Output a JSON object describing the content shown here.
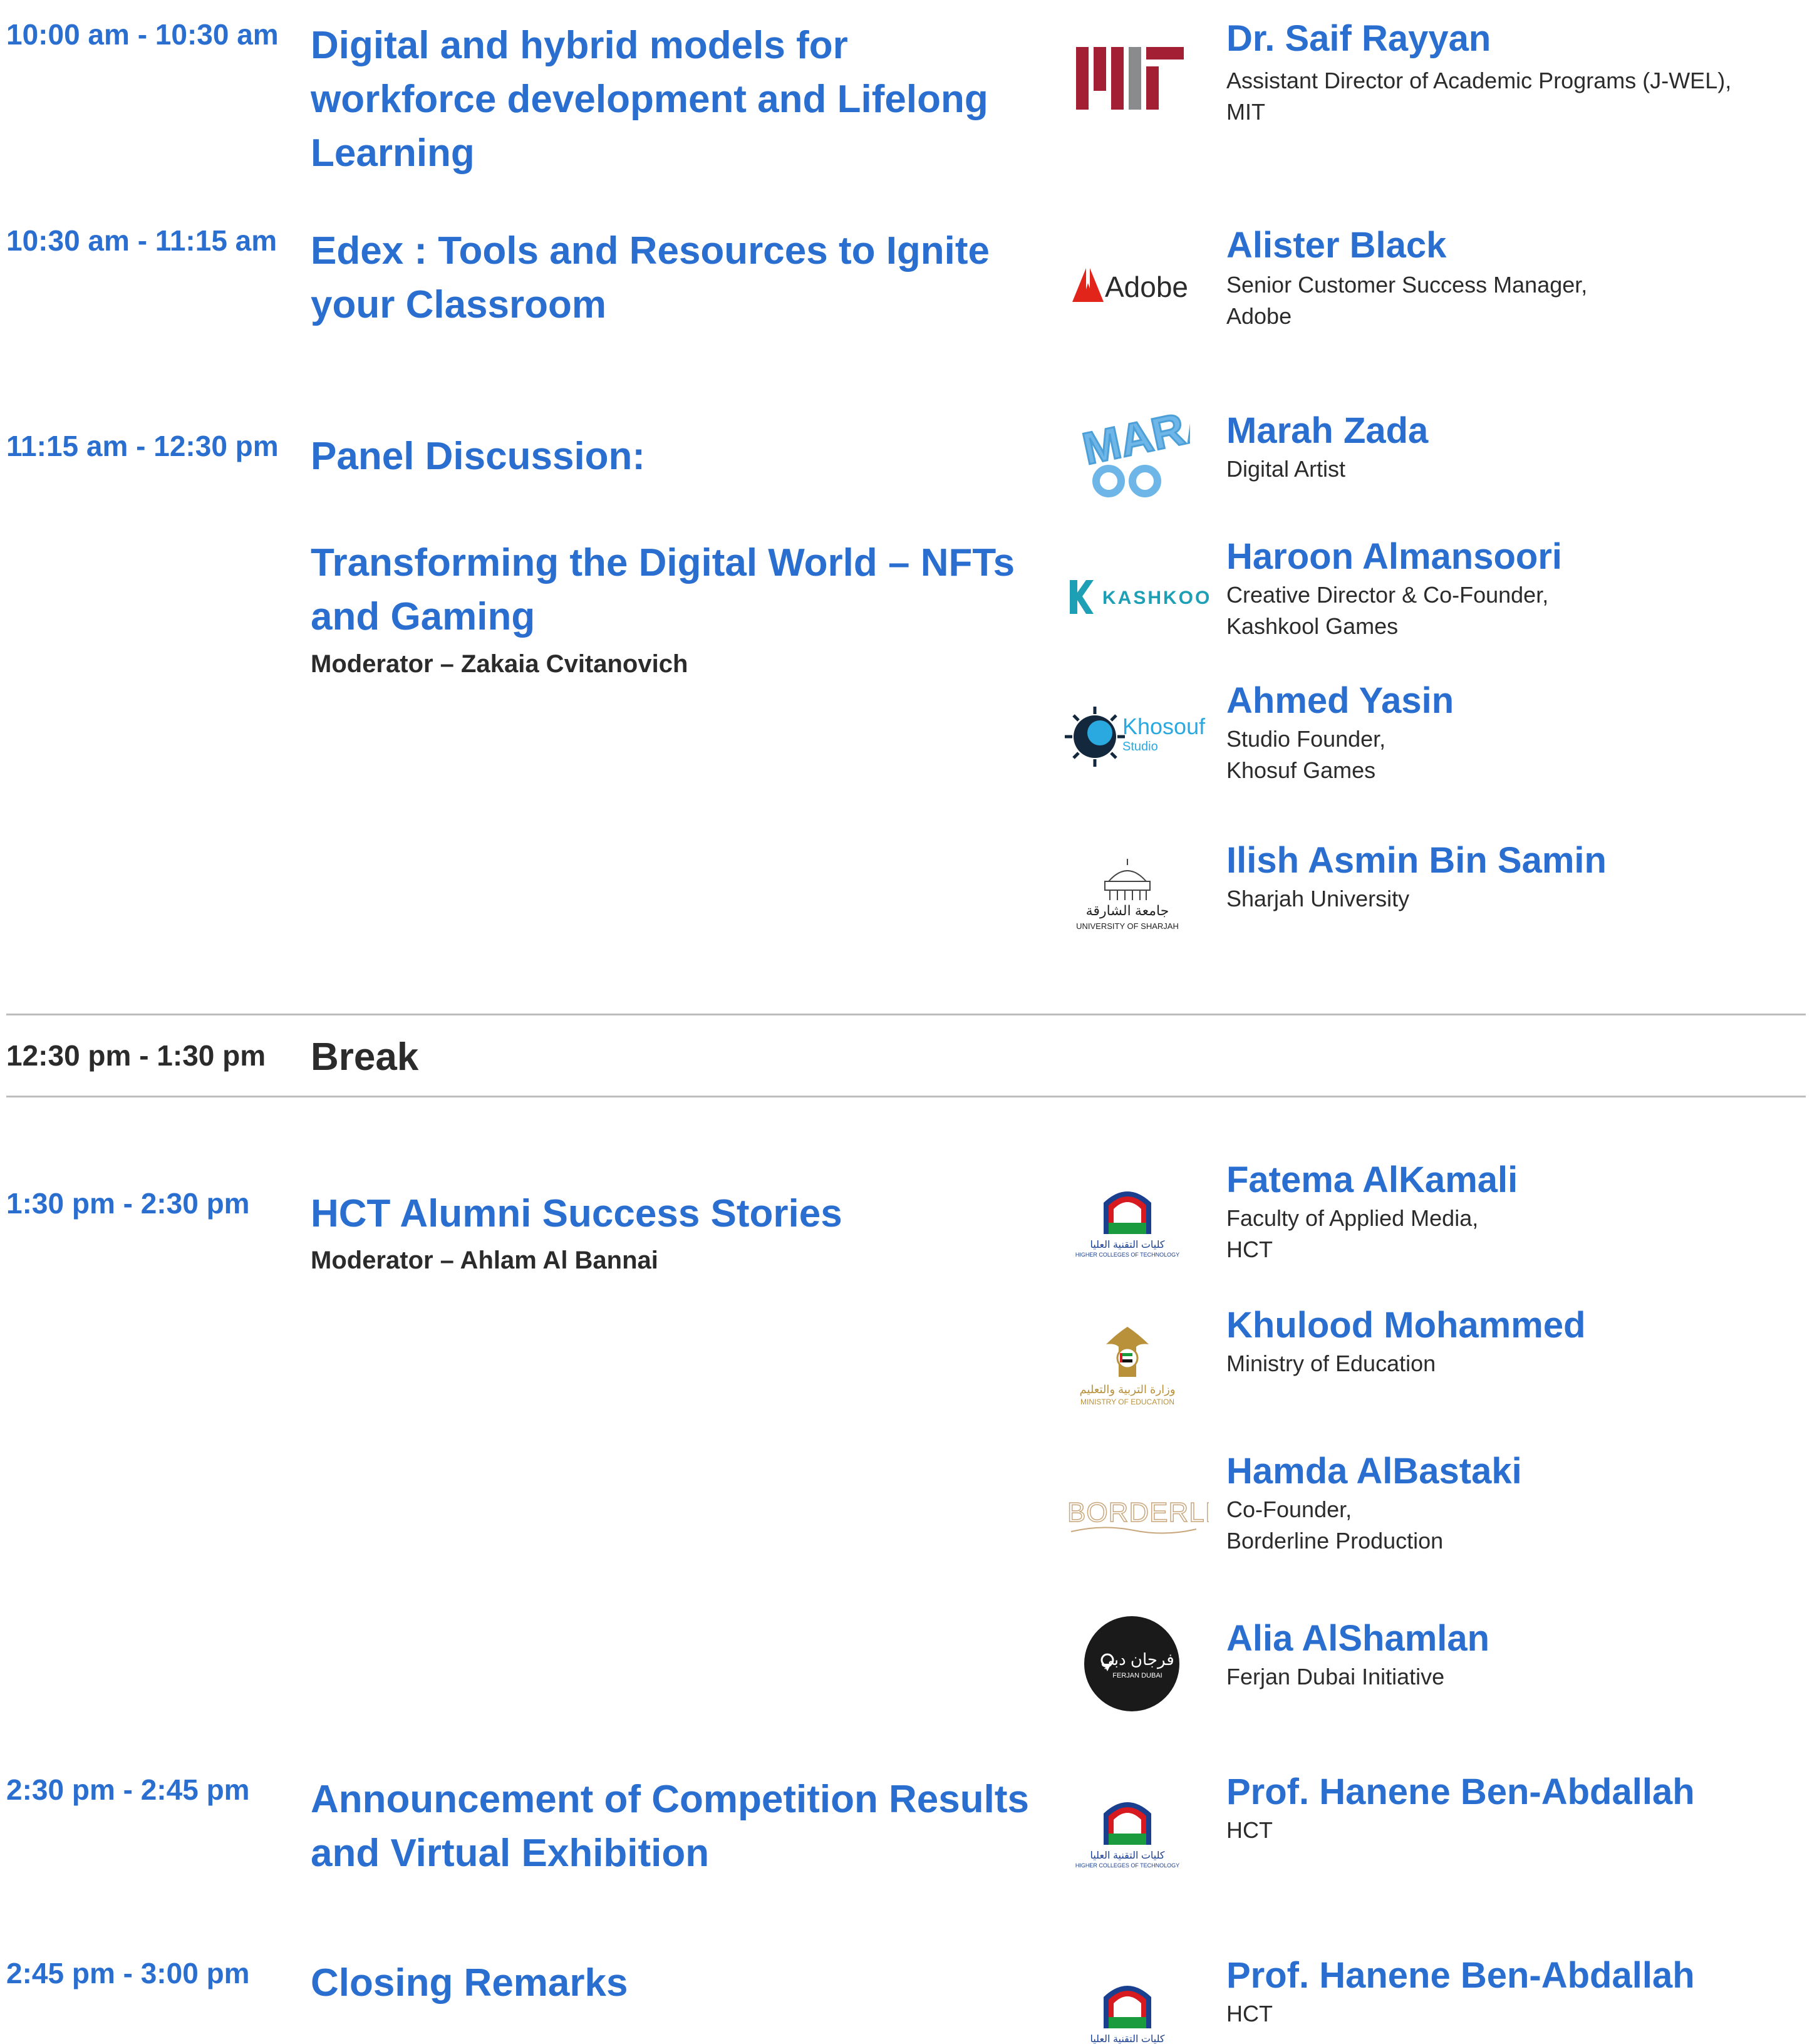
{
  "colors": {
    "accent": "#2a6fd0",
    "text": "#2b2b2b",
    "rule": "#bdbdbd"
  },
  "sessions": [
    {
      "time": "10:00 am - 10:30 am",
      "title": "Digital and hybrid models for workforce development and Lifelong Learning"
    },
    {
      "time": "10:30 am - 11:15 am",
      "title": "Edex : Tools and Resources to Ignite your Classroom"
    },
    {
      "time": "11:15 am - 12:30 pm",
      "title": "Panel Discussion:",
      "subtitle": "Transforming the Digital World – NFTs and Gaming",
      "moderator": "Moderator – Zakaia Cvitanovich"
    },
    {
      "time": "12:30 pm - 1:30 pm",
      "title": "Break"
    },
    {
      "time": "1:30 pm - 2:30 pm",
      "title": "HCT Alumni Success Stories",
      "moderator": "Moderator – Ahlam Al Bannai"
    },
    {
      "time": "2:30 pm - 2:45 pm",
      "title": "Announcement of Competition Results and Virtual Exhibition"
    },
    {
      "time": "2:45 pm - 3:00 pm",
      "title": "Closing Remarks"
    }
  ],
  "speakers": [
    {
      "name": "Dr. Saif Rayyan",
      "role_lines": [
        "Assistant Director of Academic Programs (J-WEL),",
        "MIT"
      ],
      "logo": "mit-logo"
    },
    {
      "name": "Alister Black",
      "role_lines": [
        "Senior Customer Success Manager,",
        "Adobe"
      ],
      "logo": "adobe-logo",
      "logo_text": "Adobe"
    },
    {
      "name": "Marah Zada",
      "role_lines": [
        "Digital Artist"
      ],
      "logo": "marah-logo",
      "logo_text": "MARAH"
    },
    {
      "name": "Haroon Almansoori",
      "role_lines": [
        "Creative Director & Co-Founder,",
        "Kashkool Games"
      ],
      "logo": "kashkool-logo",
      "logo_text": "KASHKOOL"
    },
    {
      "name": "Ahmed Yasin",
      "role_lines": [
        "Studio Founder,",
        "Khosuf Games"
      ],
      "logo": "khosouf-logo",
      "logo_text": "Khosouf",
      "logo_subtext": "Studio"
    },
    {
      "name": "Ilish Asmin Bin Samin",
      "role_lines": [
        "Sharjah University"
      ],
      "logo": "sharjah-university-logo",
      "logo_text": "UNIVERSITY OF SHARJAH",
      "logo_arabic": "جامعة الشارقة"
    },
    {
      "name": "Fatema AlKamali",
      "role_lines": [
        "Faculty of Applied Media,",
        "HCT"
      ],
      "logo": "hct-logo",
      "logo_text": "HIGHER COLLEGES OF TECHNOLOGY",
      "logo_arabic": "كليات التقنية العليا"
    },
    {
      "name": "Khulood Mohammed",
      "role_lines": [
        "Ministry of Education"
      ],
      "logo": "moe-logo",
      "logo_text": "MINISTRY OF EDUCATION",
      "logo_arabic": "وزارة التربية والتعليم"
    },
    {
      "name": "Hamda AlBastaki",
      "role_lines": [
        "Co-Founder,",
        "Borderline Production"
      ],
      "logo": "borderline-logo",
      "logo_text": "BORDERLINE"
    },
    {
      "name": "Alia AlShamlan",
      "role_lines": [
        "Ferjan Dubai Initiative"
      ],
      "logo": "ferjan-dubai-logo",
      "logo_text": "FERJAN DUBAI",
      "logo_arabic": "فرجان دبي"
    },
    {
      "name": "Prof. Hanene Ben-Abdallah",
      "role_lines": [
        "HCT"
      ],
      "logo": "hct-logo",
      "logo_text": "HIGHER COLLEGES OF TECHNOLOGY",
      "logo_arabic": "كليات التقنية العليا"
    },
    {
      "name": "Prof. Hanene Ben-Abdallah",
      "role_lines": [
        "HCT"
      ],
      "logo": "hct-logo",
      "logo_arabic": "كليات التقنية العليا"
    }
  ]
}
